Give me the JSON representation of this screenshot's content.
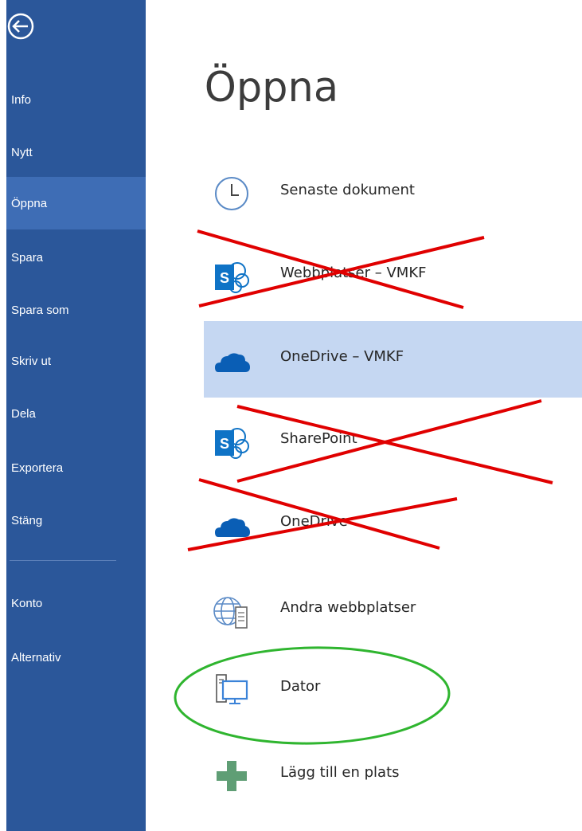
{
  "sidebar": {
    "back_icon": "back-arrow-icon",
    "items": [
      {
        "label": "Info"
      },
      {
        "label": "Nytt"
      },
      {
        "label": "Öppna",
        "active": true
      },
      {
        "label": "Spara"
      },
      {
        "label": "Spara som"
      },
      {
        "label": "Skriv ut"
      },
      {
        "label": "Dela"
      },
      {
        "label": "Exportera"
      },
      {
        "label": "Stäng"
      },
      {
        "label": "Konto"
      },
      {
        "label": "Alternativ"
      }
    ]
  },
  "main": {
    "title": "Öppna",
    "places": [
      {
        "label": "Senaste dokument",
        "icon": "clock-icon"
      },
      {
        "label": "Webbplatser – VMKF",
        "icon": "sharepoint-icon",
        "crossed_out": true
      },
      {
        "label": "OneDrive – VMKF",
        "icon": "cloud-icon",
        "selected": true
      },
      {
        "label": "SharePoint",
        "icon": "sharepoint-icon",
        "crossed_out": true
      },
      {
        "label": "OneDrive",
        "icon": "cloud-icon",
        "crossed_out": true
      },
      {
        "label": "Andra webbplatser",
        "icon": "globe-server-icon"
      },
      {
        "label": "Dator",
        "icon": "computer-icon",
        "circled": true
      },
      {
        "label": "Lägg till en plats",
        "icon": "plus-icon"
      }
    ]
  },
  "colors": {
    "sidebar_bg": "#2b579a",
    "sidebar_active": "#3e6db5",
    "selected_place": "#c5d7f2",
    "annotation_cross": "#e00000",
    "annotation_circle": "#2fb52f"
  }
}
